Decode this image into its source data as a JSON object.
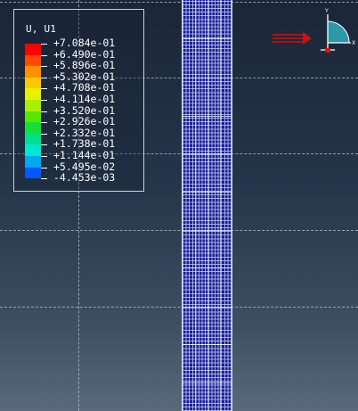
{
  "legend": {
    "title": "U, U1",
    "values": [
      "+7.084e-01",
      "+6.490e-01",
      "+5.896e-01",
      "+5.302e-01",
      "+4.708e-01",
      "+4.114e-01",
      "+3.520e-01",
      "+2.926e-01",
      "+2.332e-01",
      "+1.738e-01",
      "+1.144e-01",
      "+5.495e-02",
      "-4.453e-03"
    ],
    "colors": [
      "#ff0000",
      "#ff4a00",
      "#ff9000",
      "#ffc800",
      "#e6f000",
      "#a8f000",
      "#58e600",
      "#18dc38",
      "#00e08c",
      "#00e8d0",
      "#00a8f0",
      "#0058ff",
      "#0000e8"
    ]
  },
  "triad": {
    "y_label": "Y",
    "x_label": "X"
  },
  "colors": {
    "mesh": "#1a1f8e",
    "mesh_lines": "#c8ccff",
    "background_top": "#1b2637",
    "background_bottom": "#5a6a7c",
    "load_arrow": "#d01010"
  }
}
